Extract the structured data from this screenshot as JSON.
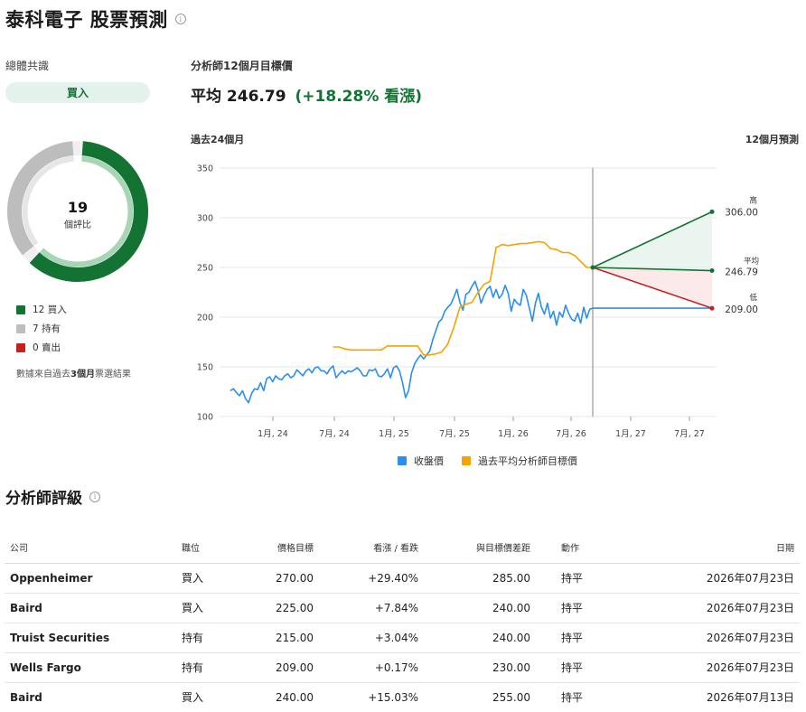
{
  "page": {
    "title": "泰科電子 股票預測",
    "info_icon": "info-icon"
  },
  "consensus": {
    "label": "總體共識",
    "rating": "買入",
    "total": "19",
    "total_caption": "個評比",
    "legend": [
      {
        "label": "12 買入",
        "count": 12,
        "color": "#137333"
      },
      {
        "label": "7 持有",
        "count": 7,
        "color": "#bdbdbd"
      },
      {
        "label": "0 賣出",
        "count": 0,
        "color": "#c5221f"
      }
    ],
    "source_prefix": "數據來自過去",
    "source_bold": "3個月",
    "source_suffix": "票選結果"
  },
  "target": {
    "label": "分析師12個月目標價",
    "avg_text": "平均 246.79",
    "change_text": "(+18.28% 看漲)"
  },
  "chart_labels": {
    "past": "過去24個月",
    "future": "12個月預測"
  },
  "chart_data": {
    "type": "line",
    "ylim": [
      100,
      350
    ],
    "yticks": [
      100,
      150,
      200,
      250,
      300,
      350
    ],
    "xticks": [
      "1月, 24",
      "7月, 24",
      "1月, 25",
      "7月, 25",
      "1月, 26",
      "7月, 26",
      "1月, 27",
      "7月, 27"
    ],
    "colors": {
      "close": "#2b8ef0",
      "target": "#f4a300",
      "high": "#137333",
      "avg": "#137333",
      "low": "#c5221f"
    },
    "series": [
      {
        "name": "收盤價",
        "x": [
          0,
          0.2,
          0.4,
          0.6,
          0.8,
          1.0,
          1.2,
          1.4,
          1.6,
          1.8,
          2.0,
          2.2,
          2.4,
          2.6,
          2.8,
          3.0,
          3.2,
          3.4,
          3.6,
          3.8,
          4.0,
          4.2,
          4.4,
          4.6,
          4.8,
          5.0,
          5.2,
          5.4,
          5.6,
          5.8,
          6.0,
          6.2,
          6.4,
          6.6,
          6.8,
          7.0,
          7.2,
          7.4,
          7.6,
          7.8,
          8.0,
          8.2,
          8.4,
          8.6,
          8.8,
          9.0,
          9.2,
          9.4,
          9.6,
          9.8,
          10.0,
          10.2,
          10.4,
          10.6,
          10.8,
          11.0,
          11.2,
          11.4,
          11.6,
          11.8,
          12.0,
          12.2,
          12.4,
          12.6,
          12.8,
          13.0,
          13.2,
          13.4,
          13.6,
          13.8,
          14.0,
          14.2,
          14.4,
          14.6,
          14.8,
          15.0,
          15.2,
          15.4,
          15.6,
          15.8,
          16.0,
          16.2,
          16.4,
          16.6,
          16.8,
          17.0,
          17.2,
          17.4,
          17.6,
          17.8,
          18.0,
          18.2,
          18.4,
          18.6,
          18.8,
          19.0,
          19.2,
          19.4,
          19.6,
          19.8,
          20.0,
          20.2,
          20.4,
          20.6,
          20.8,
          21.0,
          21.2,
          21.4,
          21.6,
          21.8,
          22.0,
          22.2,
          22.4,
          22.6,
          22.8,
          23.0,
          23.2,
          23.4,
          23.6,
          23.8,
          24.0
        ],
        "values": [
          126,
          128,
          124,
          121,
          126,
          118,
          114,
          123,
          128,
          127,
          134,
          126,
          138,
          140,
          135,
          141,
          138,
          137,
          141,
          143,
          139,
          141,
          147,
          144,
          141,
          146,
          148,
          144,
          149,
          150,
          146,
          146,
          143,
          148,
          151,
          139,
          143,
          146,
          143,
          146,
          145,
          147,
          149,
          146,
          141,
          141,
          147,
          146,
          148,
          141,
          140,
          143,
          148,
          139,
          149,
          151,
          146,
          134,
          119,
          126,
          144,
          153,
          158,
          162,
          158,
          162,
          166,
          177,
          186,
          195,
          198,
          206,
          210,
          213,
          220,
          228,
          215,
          207,
          223,
          225,
          231,
          236,
          227,
          214,
          222,
          228,
          231,
          220,
          228,
          219,
          223,
          232,
          224,
          206,
          218,
          214,
          212,
          228,
          222,
          209,
          196,
          214,
          224,
          210,
          203,
          214,
          199,
          206,
          192,
          205,
          200,
          212,
          204,
          198,
          196,
          204,
          194,
          210,
          199,
          208,
          209
        ]
      },
      {
        "name": "過去平均分析師目標價",
        "x": [
          6.8,
          7.2,
          7.6,
          8.0,
          8.4,
          8.8,
          9.2,
          9.6,
          10.0,
          10.4,
          10.8,
          11.2,
          11.6,
          12.0,
          12.4,
          12.8,
          13.2,
          13.6,
          14.0,
          14.4,
          14.8,
          15.2,
          15.6,
          16.0,
          16.4,
          16.8,
          17.2,
          17.6,
          18.0,
          18.4,
          18.8,
          19.2,
          19.6,
          20.0,
          20.4,
          20.8,
          21.2,
          21.6,
          22.0,
          22.4,
          22.8,
          23.2,
          23.6,
          24.0
        ],
        "values": [
          170,
          170,
          168,
          167,
          167,
          167,
          167,
          167,
          167,
          171,
          171,
          171,
          171,
          171,
          171,
          162,
          162,
          163,
          165,
          173,
          190,
          210,
          213,
          215,
          225,
          233,
          236,
          270,
          273,
          272,
          273,
          274,
          274,
          275,
          276,
          275,
          269,
          268,
          265,
          265,
          262,
          256,
          250,
          250
        ]
      }
    ],
    "forecast": [
      {
        "name": "高",
        "value": 306.0,
        "label": "306.00"
      },
      {
        "name": "平均",
        "value": 246.79,
        "label": "246.79"
      },
      {
        "name": "低",
        "value": 209.0,
        "label": "209.00"
      }
    ],
    "current": 209,
    "legend": [
      {
        "name": "收盤價",
        "color": "#2b8ef0"
      },
      {
        "name": "過去平均分析師目標價",
        "color": "#f4a300"
      }
    ]
  },
  "ratings": {
    "title": "分析師評級",
    "headers": [
      "公司",
      "職位",
      "價格目標",
      "看漲 / 看跌",
      "與目標價差距",
      "動作",
      "日期"
    ],
    "rows": [
      {
        "company": "Oppenheimer",
        "position": "買入",
        "target": "270.00",
        "updown": "+29.40%",
        "gap": "285.00",
        "action": "持平",
        "date": "2026年07月23日"
      },
      {
        "company": "Baird",
        "position": "買入",
        "target": "225.00",
        "updown": "+7.84%",
        "gap": "240.00",
        "action": "持平",
        "date": "2026年07月23日"
      },
      {
        "company": "Truist Securities",
        "position": "持有",
        "target": "215.00",
        "updown": "+3.04%",
        "gap": "240.00",
        "action": "持平",
        "date": "2026年07月23日"
      },
      {
        "company": "Wells Fargo",
        "position": "持有",
        "target": "209.00",
        "updown": "+0.17%",
        "gap": "230.00",
        "action": "持平",
        "date": "2026年07月23日"
      },
      {
        "company": "Baird",
        "position": "買入",
        "target": "240.00",
        "updown": "+15.03%",
        "gap": "255.00",
        "action": "持平",
        "date": "2026年07月13日"
      }
    ]
  }
}
